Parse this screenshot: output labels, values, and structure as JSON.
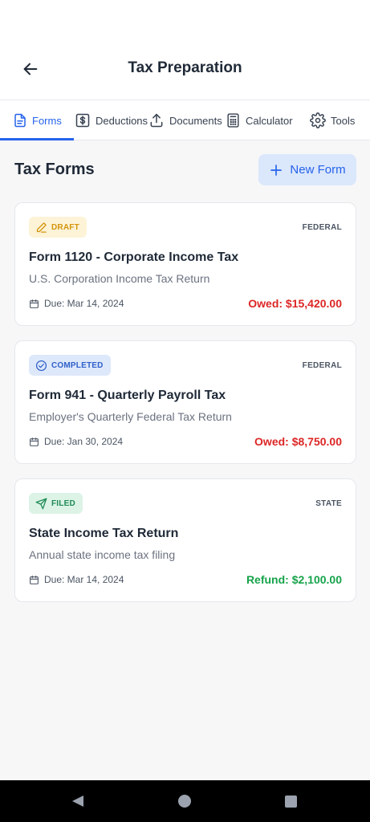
{
  "header": {
    "title": "Tax Preparation"
  },
  "tabs": [
    {
      "label": "Forms",
      "icon": "document-icon",
      "active": true
    },
    {
      "label": "Deductions",
      "icon": "dollar-icon",
      "active": false
    },
    {
      "label": "Documents",
      "icon": "upload-icon",
      "active": false
    },
    {
      "label": "Calculator",
      "icon": "calculator-icon",
      "active": false
    },
    {
      "label": "Tools",
      "icon": "gear-icon",
      "active": false
    }
  ],
  "section": {
    "title": "Tax Forms",
    "new_button_label": "New Form"
  },
  "forms": [
    {
      "status": "DRAFT",
      "status_icon": "pencil-icon",
      "jurisdiction": "FEDERAL",
      "title": "Form 1120 - Corporate Income Tax",
      "subtitle": "U.S. Corporation Income Tax Return",
      "due": "Due: Mar 14, 2024",
      "amount": "Owed: $15,420.00"
    },
    {
      "status": "COMPLETED",
      "status_icon": "check-circle-icon",
      "jurisdiction": "FEDERAL",
      "title": "Form 941 - Quarterly Payroll Tax",
      "subtitle": "Employer's Quarterly Federal Tax Return",
      "due": "Due: Jan 30, 2024",
      "amount": "Owed: $8,750.00"
    },
    {
      "status": "FILED",
      "status_icon": "send-icon",
      "jurisdiction": "STATE",
      "title": "State Income Tax Return",
      "subtitle": "Annual state income tax filing",
      "due": "Due: Mar 14, 2024",
      "amount": "Refund: $2,100.00"
    }
  ],
  "colors": {
    "accent": "#2563eb",
    "owed": "#dc2626",
    "refund": "#16a34a",
    "draft": "#d4950d",
    "completed": "#2f5fc9",
    "filed": "#1f8a55"
  }
}
